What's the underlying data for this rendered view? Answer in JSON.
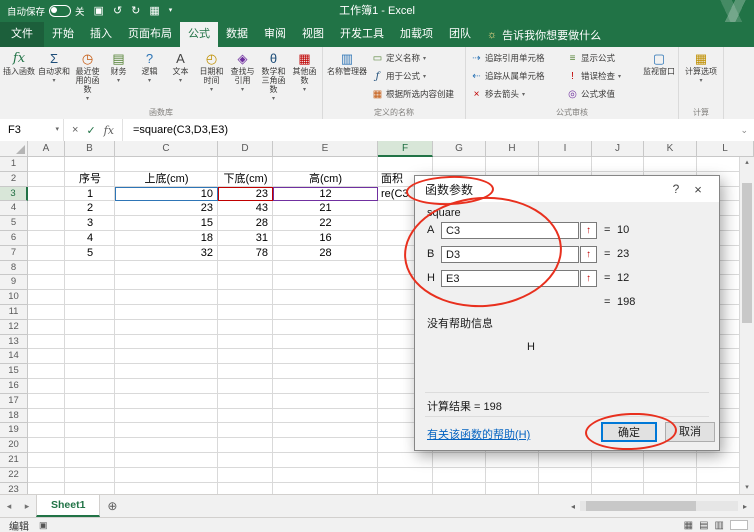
{
  "colors": {
    "excel_green": "#217346",
    "annotation_red": "#e8301e",
    "link_blue": "#0563c1",
    "focus_blue": "#0078d7"
  },
  "icons": {
    "save": "▣",
    "undo": "↺",
    "redo": "↻",
    "grid": "▦",
    "qat_more": "▾",
    "bulb": "☼",
    "fx": "fx",
    "autosum": "Σ",
    "recent": "◷",
    "finance": "▤",
    "logic": "?",
    "text": "A",
    "datetime": "◴",
    "lookup": "◈",
    "math": "θ",
    "more_fn": "▦",
    "name_manager": "▥",
    "define_name": "▭",
    "use_formula": "ƒ",
    "create_sel": "▦",
    "precedents": "⇢",
    "dependents": "⇠",
    "remove_arrows": "×",
    "show_formulas": "≡",
    "error_check": "!",
    "evaluate": "◎",
    "watch": "▢",
    "calc_opt": "▦",
    "dropdown": "▾",
    "cancel": "×",
    "enter": "✓",
    "collapse": "↑",
    "help": "?",
    "close": "×",
    "nav_left": "◂",
    "nav_right": "▸",
    "add_sheet": "⊕",
    "view_normal": "▦",
    "view_layout": "▤",
    "view_break": "▥",
    "macro": "▣",
    "fbar_expand": "⌄",
    "scroll_up": "▴",
    "scroll_down": "▾"
  },
  "titlebar": {
    "autosave_label": "自动保存",
    "autosave_state": "关",
    "title": "工作簿1 - Excel"
  },
  "ribbon": {
    "tabs": [
      {
        "label": "文件",
        "file": true
      },
      {
        "label": "开始"
      },
      {
        "label": "插入"
      },
      {
        "label": "页面布局"
      },
      {
        "label": "公式",
        "selected": true
      },
      {
        "label": "数据"
      },
      {
        "label": "审阅"
      },
      {
        "label": "视图"
      },
      {
        "label": "开发工具"
      },
      {
        "label": "加载项"
      },
      {
        "label": "团队"
      }
    ],
    "tell_me": "告诉我你想要做什么",
    "groups": [
      {
        "label": "函数库",
        "items": [
          "插入函数",
          "自动求和",
          "最近使用的函数",
          "财务",
          "逻辑",
          "文本",
          "日期和时间",
          "查找与引用",
          "数学和三角函数",
          "其他函数"
        ]
      },
      {
        "label": "定义的名称",
        "items": [
          "名称管理器",
          "定义名称",
          "用于公式",
          "根据所选内容创建"
        ]
      },
      {
        "label": "公式审核",
        "items": [
          "追踪引用单元格",
          "追踪从属单元格",
          "移去箭头",
          "显示公式",
          "错误检查",
          "公式求值",
          "监视窗口"
        ]
      },
      {
        "label": "计算",
        "items": [
          "计算选项"
        ]
      }
    ]
  },
  "formula_bar": {
    "name_box": "F3",
    "formula": "=square(C3,D3,E3)"
  },
  "grid": {
    "column_headers": [
      "A",
      "B",
      "C",
      "D",
      "E",
      "F",
      "G",
      "H",
      "I",
      "J",
      "K",
      "L"
    ],
    "row_count": 23,
    "selected_column": "F",
    "selected_row": 3,
    "cells": [
      {
        "r": 2,
        "c": "B",
        "v": "序号",
        "a": "c"
      },
      {
        "r": 2,
        "c": "C",
        "v": "上底(cm)",
        "a": "c"
      },
      {
        "r": 2,
        "c": "D",
        "v": "下底(cm)",
        "a": "c"
      },
      {
        "r": 2,
        "c": "E",
        "v": "高(cm)",
        "a": "c"
      },
      {
        "r": 2,
        "c": "F",
        "v": "面积",
        "a": "l"
      },
      {
        "r": 3,
        "c": "B",
        "v": "1",
        "a": "c"
      },
      {
        "r": 3,
        "c": "C",
        "v": "10",
        "a": "r"
      },
      {
        "r": 3,
        "c": "D",
        "v": "23",
        "a": "r"
      },
      {
        "r": 3,
        "c": "E",
        "v": "12",
        "a": "c"
      },
      {
        "r": 3,
        "c": "F",
        "v": "re(C3",
        "a": "l"
      },
      {
        "r": 4,
        "c": "B",
        "v": "2",
        "a": "c"
      },
      {
        "r": 4,
        "c": "C",
        "v": "23",
        "a": "r"
      },
      {
        "r": 4,
        "c": "D",
        "v": "43",
        "a": "r"
      },
      {
        "r": 4,
        "c": "E",
        "v": "21",
        "a": "c"
      },
      {
        "r": 5,
        "c": "B",
        "v": "3",
        "a": "c"
      },
      {
        "r": 5,
        "c": "C",
        "v": "15",
        "a": "r"
      },
      {
        "r": 5,
        "c": "D",
        "v": "28",
        "a": "r"
      },
      {
        "r": 5,
        "c": "E",
        "v": "22",
        "a": "c"
      },
      {
        "r": 6,
        "c": "B",
        "v": "4",
        "a": "c"
      },
      {
        "r": 6,
        "c": "C",
        "v": "18",
        "a": "r"
      },
      {
        "r": 6,
        "c": "D",
        "v": "31",
        "a": "r"
      },
      {
        "r": 6,
        "c": "E",
        "v": "16",
        "a": "c"
      },
      {
        "r": 7,
        "c": "B",
        "v": "5",
        "a": "c"
      },
      {
        "r": 7,
        "c": "C",
        "v": "32",
        "a": "r"
      },
      {
        "r": 7,
        "c": "D",
        "v": "78",
        "a": "r"
      },
      {
        "r": 7,
        "c": "E",
        "v": "28",
        "a": "c"
      }
    ],
    "reference_highlights": [
      {
        "cell": "C3",
        "color": "#2e75b6"
      },
      {
        "cell": "D3",
        "color": "#c00000"
      },
      {
        "cell": "E3",
        "color": "#7030a0"
      }
    ]
  },
  "dialog": {
    "title": "函数参数",
    "function_name": "square",
    "params": [
      {
        "label": "A",
        "ref": "C3",
        "eq": "=",
        "value": "10"
      },
      {
        "label": "B",
        "ref": "D3",
        "eq": "=",
        "value": "23"
      },
      {
        "label": "H",
        "ref": "E3",
        "eq": "=",
        "value": "12"
      }
    ],
    "formula_result": {
      "eq": "=",
      "value": "198"
    },
    "no_help_text": "没有帮助信息",
    "param_hint": "H",
    "calc_result": "计算结果 = 198",
    "help_link": "有关该函数的帮助(H)",
    "ok_label": "确定",
    "cancel_label": "取消"
  },
  "sheet": {
    "tabs": [
      "Sheet1"
    ],
    "active": "Sheet1"
  },
  "status": {
    "mode": "编辑"
  }
}
